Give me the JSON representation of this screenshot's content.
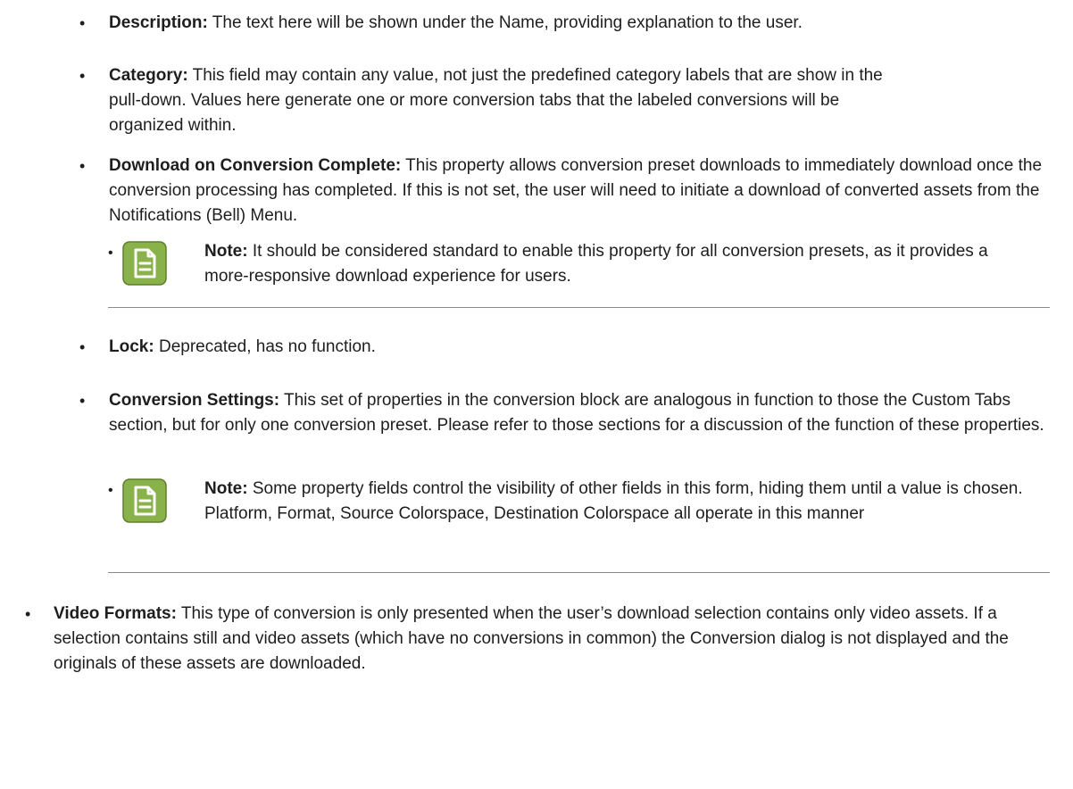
{
  "items": [
    {
      "term": "Description:",
      "body": " The text here will be shown under the Name, providing explanation to the user."
    },
    {
      "term": "Category:",
      "body": " This field may contain any value, not just the predefined category labels that are show in the pull-down. Values here generate one or more conversion tabs that the labeled conversions will be organized within."
    },
    {
      "term": "Download on Conversion Complete:",
      "body": " This property allows conversion preset downloads to immediately download once the conversion processing has completed. If this is not set, the user will need to initiate a download of converted assets from the Notifications (Bell) Menu."
    },
    {
      "term": "Lock:",
      "body": " Deprecated, has no function."
    },
    {
      "term": "Conversion Settings:",
      "body": " This set of properties in the conversion block are analogous in function to those the Custom Tabs section, but for only one conversion preset. Please refer to those sections for a discussion of the function of these properties."
    },
    {
      "term": "Video Formats:",
      "body": " This type of conversion is only presented when the user’s download selection contains only video assets. If a selection contains still and video assets (which have no conversions in common) the Conversion dialog is not displayed and the originals of these assets are downloaded."
    }
  ],
  "notes": [
    {
      "label": "Note:",
      "body": " It should be considered standard to enable this property for all conversion presets, as it provides a more-responsive download experience for users.",
      "icon": "document-note-icon"
    },
    {
      "label": "Note:",
      "body": " Some property fields control the visibility of other fields in this form, hiding them until a value is chosen. Platform, Format, Source Colorspace, Destination Colorspace all operate in this manner",
      "icon": "document-note-icon"
    }
  ],
  "colors": {
    "icon_fill": "#8ab24a",
    "icon_border": "#5f7f2c",
    "text": "#1e1e1e",
    "rule": "#8a8a8a"
  }
}
